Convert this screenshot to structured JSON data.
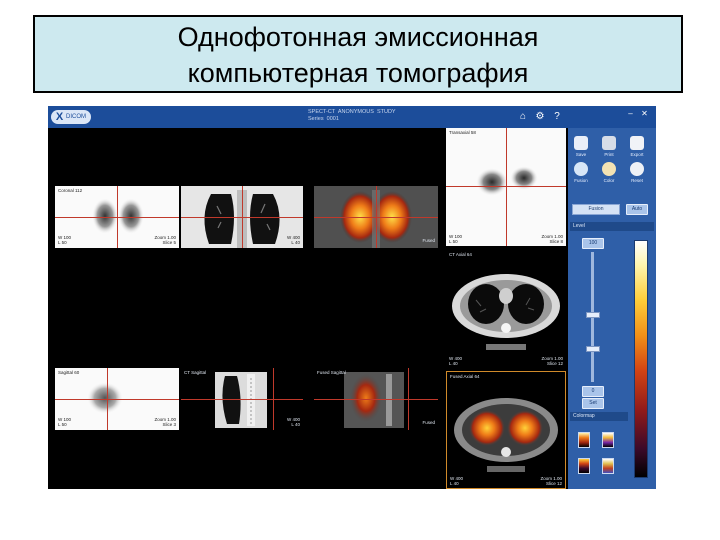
{
  "slide": {
    "title_line1": "Однофотонная эмиссионная",
    "title_line2": "компьютерная томография"
  },
  "app": {
    "logo_text": "DICOM",
    "header_line1": "SPECT-CT  ANONYMOUS  STUDY",
    "header_line2": "Series  0001",
    "icons": [
      "home-icon",
      "gear-icon",
      "help-icon",
      "minimize-icon",
      "close-icon"
    ],
    "toolbar_buttons": [
      {
        "name": "save-icon",
        "label": "Save",
        "color": "#e9eef8"
      },
      {
        "name": "print-icon",
        "label": "Print",
        "color": "#d7dde8"
      },
      {
        "name": "export-icon",
        "label": "Export",
        "color": "#f1f3f7"
      },
      {
        "name": "fusion-icon",
        "label": "Fusion",
        "color": "#d7e6f7"
      },
      {
        "name": "color-icon",
        "label": "Color",
        "color": "#f3e2b3"
      },
      {
        "name": "reset-icon",
        "label": "Reset",
        "color": "#eef1f6"
      }
    ],
    "panel_field_label": "Fusion",
    "panel_button": "Auto",
    "panel_strip": "Level",
    "slider_top_value": "100",
    "slider_bottom_value": "0",
    "preset_button": "Set",
    "lower_strip": "Colormap"
  },
  "viewports": {
    "spect_coronal": {
      "top_label": "Coronal 112",
      "bottom_left": "W 100\nL 50",
      "bottom_right": "Zoom 1.00\nSlice 5"
    },
    "ct_coronal": {
      "top_label": "",
      "bottom_left": "",
      "bottom_right": "W 400\nL 40"
    },
    "fused_coronal": {
      "top_label": "",
      "bottom_left": "",
      "bottom_right": "Fused"
    },
    "spect_axial": {
      "top_label": "Transaxial 58",
      "bottom_left": "W 100\nL 50",
      "bottom_right": "Zoom 1.00\nSlice 8"
    },
    "ct_axial": {
      "top_label": "CT Axial 64",
      "bottom_left": "W 400\nL 40",
      "bottom_right": "Zoom 1.00\nSlice 12"
    },
    "spect_sagittal": {
      "top_label": "Sagittal 60",
      "bottom_left": "W 100\nL 50",
      "bottom_right": "Zoom 1.00\nSlice 3"
    },
    "ct_sagittal": {
      "top_label": "CT Sagittal",
      "bottom_left": "",
      "bottom_right": "W 400\nL 40"
    },
    "fused_sagittal": {
      "top_label": "Fused Sagittal",
      "bottom_left": "",
      "bottom_right": "Fused"
    },
    "fused_axial": {
      "top_label": "Fused Axial 64",
      "bottom_left": "W 400\nL 40",
      "bottom_right": "Zoom 1.00\nSlice 12"
    }
  },
  "colors": {
    "slide_title_bg": "#cde9ef",
    "app_header": "#1c4d9a",
    "panel": "#2f5fa8",
    "crosshair": "#c0392b",
    "active_viewport_border": "#d08a2a"
  }
}
